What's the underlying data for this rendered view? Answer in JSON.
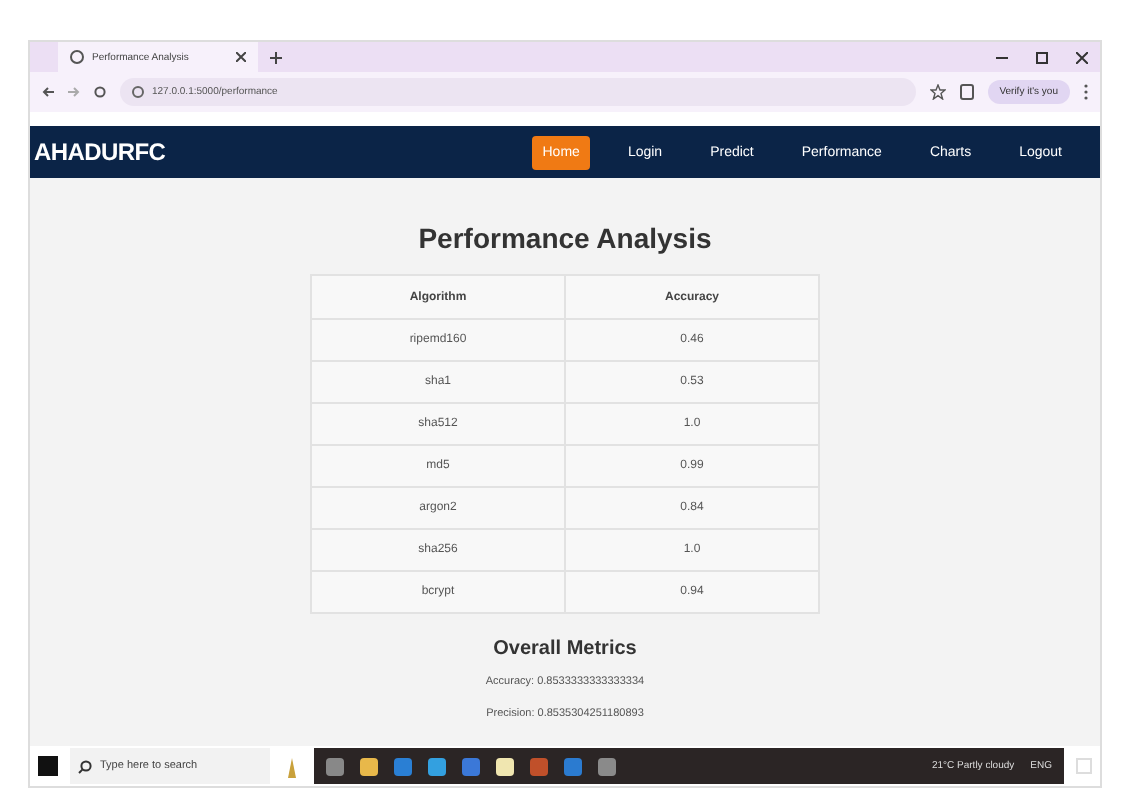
{
  "browser": {
    "tab_title": "Performance Analysis",
    "url": "127.0.0.1:5000/performance",
    "profile": "Verify it's you"
  },
  "navbar": {
    "brand": "AHADURFC",
    "links": [
      {
        "label": "Home",
        "selected": true
      },
      {
        "label": "Login",
        "selected": false
      },
      {
        "label": "Predict",
        "selected": false
      },
      {
        "label": "Performance",
        "selected": false
      },
      {
        "label": "Charts",
        "selected": false
      },
      {
        "label": "Logout",
        "selected": false
      }
    ]
  },
  "title": "Performance Analysis",
  "table": {
    "columns": [
      "Algorithm",
      "Accuracy"
    ],
    "rows": [
      [
        "ripemd160",
        "0.46"
      ],
      [
        "sha1",
        "0.53"
      ],
      [
        "sha512",
        "1.0"
      ],
      [
        "md5",
        "0.99"
      ],
      [
        "argon2",
        "0.84"
      ],
      [
        "sha256",
        "1.0"
      ],
      [
        "bcrypt",
        "0.94"
      ]
    ]
  },
  "metrics": {
    "title": "Overall Metrics",
    "items": [
      "Accuracy: 0.8533333333333334",
      "Precision: 0.8535304251180893"
    ]
  },
  "taskbar": {
    "search_placeholder": "Type here to search",
    "weather": "21°C Partly cloudy",
    "language": "ENG"
  }
}
